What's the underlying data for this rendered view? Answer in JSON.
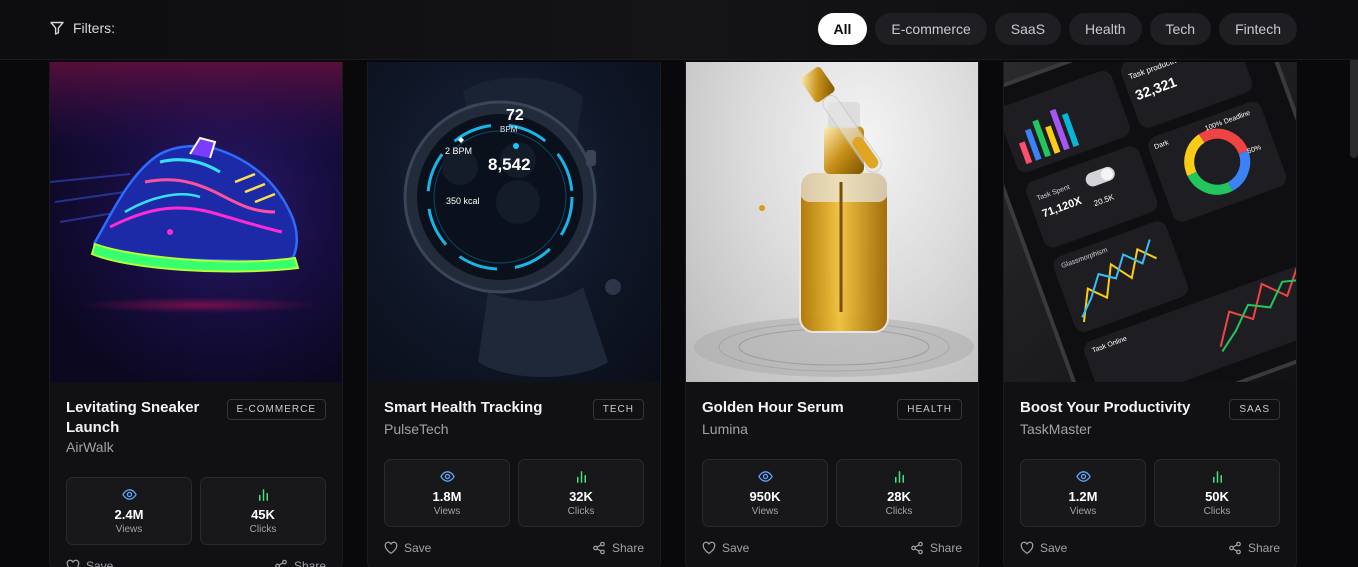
{
  "filters": {
    "label": "Filters:",
    "options": [
      "All",
      "E-commerce",
      "SaaS",
      "Health",
      "Tech",
      "Fintech"
    ],
    "selected": "All"
  },
  "cards": [
    {
      "title": "Levitating Sneaker Launch",
      "brand": "AirWalk",
      "tag": "E-COMMERCE",
      "views": "2.4M",
      "views_label": "Views",
      "clicks": "45K",
      "clicks_label": "Clicks",
      "save_label": "Save",
      "share_label": "Share",
      "image_icon": "neon-sneaker"
    },
    {
      "title": "Smart Health Tracking",
      "brand": "PulseTech",
      "tag": "TECH",
      "views": "1.8M",
      "views_label": "Views",
      "clicks": "32K",
      "clicks_label": "Clicks",
      "save_label": "Save",
      "share_label": "Share",
      "image_icon": "smartwatch",
      "watch": {
        "bpm": "72",
        "bpm_unit": "BPM",
        "steps": "8,542",
        "stat_left": "2 BPM",
        "kcal": "350 kcal"
      }
    },
    {
      "title": "Golden Hour Serum",
      "brand": "Lumina",
      "tag": "HEALTH",
      "views": "950K",
      "views_label": "Views",
      "clicks": "28K",
      "clicks_label": "Clicks",
      "save_label": "Save",
      "share_label": "Share",
      "image_icon": "serum-bottle"
    },
    {
      "title": "Boost Your Productivity",
      "brand": "TaskMaster",
      "tag": "SAAS",
      "views": "1.2M",
      "views_label": "Views",
      "clicks": "50K",
      "clicks_label": "Clicks",
      "save_label": "Save",
      "share_label": "Share",
      "image_icon": "dashboard-phone",
      "phone": {
        "w1": "Task productive",
        "n1": "32,321",
        "w2": "20.5K",
        "w3": "Task Spent",
        "n3": "71,120X",
        "w4": "Glassmorphism",
        "w5": "Task Online",
        "w6": "Deadline",
        "w7": "Dark",
        "pct1": "100%",
        "pct2": "50%"
      }
    }
  ],
  "colors": {
    "background": "#09090b",
    "card": "#111113",
    "chip_active": "#ffffff",
    "chip": "#1f1f23"
  }
}
